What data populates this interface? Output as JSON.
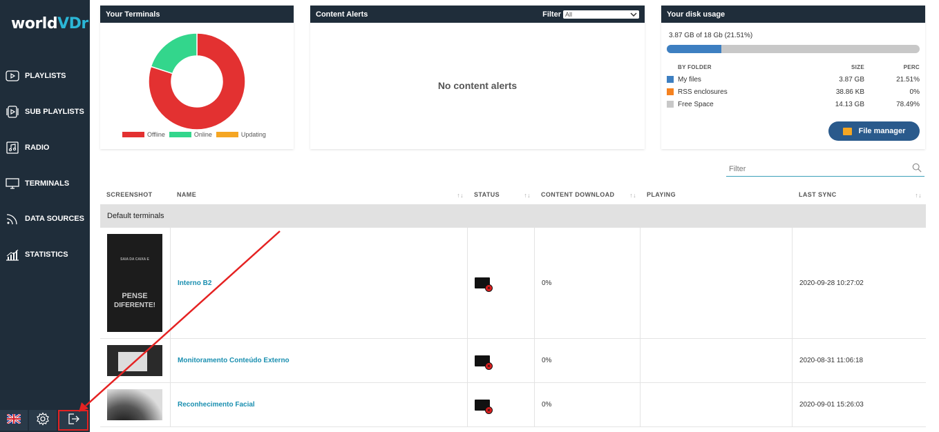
{
  "brand": {
    "logo_main": "world",
    "logo_accent": "VD",
    "logo_tail": "r"
  },
  "sidebar": {
    "items": [
      {
        "label": "PLAYLISTS",
        "icon": "playlist-icon"
      },
      {
        "label": "SUB PLAYLISTS",
        "icon": "sub-playlist-icon"
      },
      {
        "label": "RADIO",
        "icon": "radio-icon"
      },
      {
        "label": "TERMINALS",
        "icon": "monitor-icon"
      },
      {
        "label": "DATA SOURCES",
        "icon": "data-sources-icon"
      },
      {
        "label": "STATISTICS",
        "icon": "statistics-icon"
      }
    ],
    "bottom": [
      "uk-flag-icon",
      "gear-icon",
      "logout-icon"
    ]
  },
  "terminals_card": {
    "title": "Your Terminals",
    "legend": [
      {
        "label": "Offline",
        "color": "#e33131"
      },
      {
        "label": "Online",
        "color": "#33d68c"
      },
      {
        "label": "Updating",
        "color": "#f5a623"
      }
    ]
  },
  "chart_data": {
    "type": "pie",
    "series": [
      {
        "name": "Offline",
        "values": [
          80
        ]
      },
      {
        "name": "Online",
        "values": [
          20
        ]
      },
      {
        "name": "Updating",
        "values": [
          0
        ]
      }
    ],
    "legend_position": "bottom"
  },
  "alerts_card": {
    "title": "Content Alerts",
    "filter_label": "Filter",
    "filter_value": "All",
    "empty_text": "No content alerts"
  },
  "disk_card": {
    "title": "Your disk usage",
    "summary": "3.87 GB of 18 Gb (21.51%)",
    "used_fraction": 0.2151,
    "columns": {
      "folder": "BY FOLDER",
      "size": "SIZE",
      "perc": "PERC"
    },
    "rows": [
      {
        "name": "My files",
        "size": "3.87 GB",
        "perc": "21.51%",
        "color": "#3d7fc1"
      },
      {
        "name": "RSS enclosures",
        "size": "38.86 KB",
        "perc": "0%",
        "color": "#f58220"
      },
      {
        "name": "Free Space",
        "size": "14.13 GB",
        "perc": "78.49%",
        "color": "#c8c8c8"
      }
    ],
    "button_label": "File manager"
  },
  "table": {
    "filter_placeholder": "Filter",
    "columns": [
      "SCREENSHOT",
      "NAME",
      "STATUS",
      "CONTENT DOWNLOAD",
      "PLAYING",
      "LAST SYNC"
    ],
    "group": "Default terminals",
    "rows": [
      {
        "name": "Interno B2",
        "download": "0%",
        "playing": "",
        "last_sync": "2020-09-28 10:27:02"
      },
      {
        "name": "Monitoramento Conteúdo Externo",
        "download": "0%",
        "playing": "",
        "last_sync": "2020-08-31 11:06:18"
      },
      {
        "name": "Reconhecimento Facial",
        "download": "0%",
        "playing": "",
        "last_sync": "2020-09-01 15:26:03"
      }
    ]
  },
  "thumbnail_text": {
    "line1": "SAIA DA CAIXA E",
    "line2": "PENSE",
    "line3": "DIFERENTE!"
  }
}
